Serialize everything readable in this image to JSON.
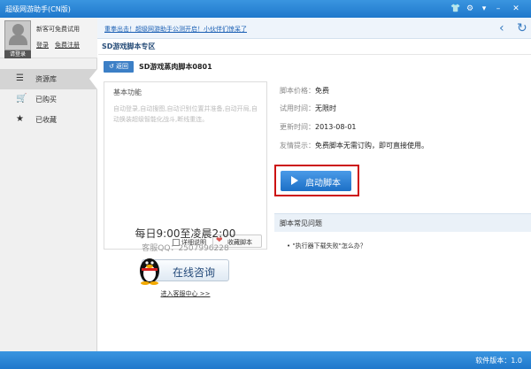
{
  "window": {
    "title": "超级网游助手(CN版)"
  },
  "user": {
    "guest_text": "新客可免费试用",
    "login_button": "请登录",
    "login_link": "登录",
    "register_link": "免费注册"
  },
  "notice": {
    "text": "重拳出击！超级网游助手公测开启！小伙伴们惊呆了"
  },
  "sidebar": {
    "items": [
      {
        "label": "资源库",
        "icon": "list-icon"
      },
      {
        "label": "已购买",
        "icon": "cart-icon"
      },
      {
        "label": "已收藏",
        "icon": "star-icon"
      }
    ]
  },
  "main": {
    "breadcrumb": "SD游戏脚本专区",
    "return_label": "返回",
    "script_title": "SD游戏蒸肉脚本0801",
    "box": {
      "heading": "基本功能",
      "description": "自动登录,自动搜图,自动识别位置并准备,自动开局,自动换装超级智能化战斗,断线重连。",
      "detail_label": "详细说明",
      "fav_label": "收藏脚本"
    },
    "info": {
      "price_label": "脚本价格：",
      "price_value": "免费",
      "trial_label": "试用时间：",
      "trial_value": "无限时",
      "update_label": "更新时间：",
      "update_value": "2013-08-01",
      "tip_label": "友情提示：",
      "tip_value": "免费脚本无需订购，即可直接使用。"
    },
    "launch_label": "启动脚本",
    "faq": {
      "title": "脚本常见问题",
      "item": "\"执行器下载失败\"怎么办？"
    },
    "service": {
      "hours": "每日9:00至凌晨2:00",
      "qq": "客服QQ：2507996228",
      "consult_label": "在线咨询",
      "center_link": "进入客服中心 >>"
    }
  },
  "status": {
    "text": "软件版本：1.0"
  },
  "colors": {
    "title_bar": "#2a87d8",
    "accent": "#1c6fc6",
    "highlight_frame": "#cc1111"
  }
}
